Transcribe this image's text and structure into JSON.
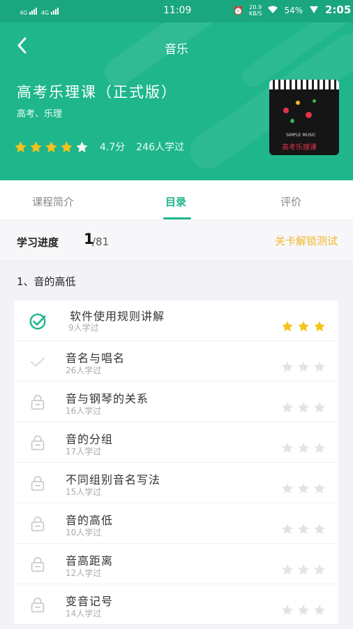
{
  "status_bar": {
    "network1": "4G",
    "network2": "4G",
    "time": "11:09",
    "speed": "20.9",
    "speed_unit": "KB/S",
    "battery": "54%",
    "clock": "2:05"
  },
  "nav": {
    "title": "音乐"
  },
  "course": {
    "title": "高考乐理课（正式版）",
    "tags": "高考、乐理",
    "rating_stars": 4.5,
    "score": "4.7分",
    "learners": "246人学过",
    "cover": {
      "caption": "SIMPLE MUSIC",
      "title": "高考乐理课"
    }
  },
  "tabs": [
    {
      "label": "课程简介",
      "active": false
    },
    {
      "label": "目录",
      "active": true
    },
    {
      "label": "评价",
      "active": false
    }
  ],
  "progress": {
    "label": "学习进度",
    "current": "1",
    "total": "/81",
    "unlock": "关卡解锁测试"
  },
  "section": {
    "title": "1、音的高低"
  },
  "lessons": [
    {
      "name": "软件使用规则讲解",
      "count": "9人学过",
      "state": "done",
      "stars": 3
    },
    {
      "name": "音名与唱名",
      "count": "26人学过",
      "state": "available",
      "stars": 0
    },
    {
      "name": "音与钢琴的关系",
      "count": "16人学过",
      "state": "locked",
      "stars": 0
    },
    {
      "name": "音的分组",
      "count": "17人学过",
      "state": "locked",
      "stars": 0
    },
    {
      "name": "不同组别音名写法",
      "count": "15人学过",
      "state": "locked",
      "stars": 0
    },
    {
      "name": "音的高低",
      "count": "10人学过",
      "state": "locked",
      "stars": 0
    },
    {
      "name": "音高距离",
      "count": "12人学过",
      "state": "locked",
      "stars": 0
    },
    {
      "name": "变音记号",
      "count": "14人学过",
      "state": "locked",
      "stars": 0
    }
  ],
  "colors": {
    "brand": "#1fb68b",
    "star_gold": "#f7c21b",
    "star_gray": "#e3e3e6",
    "unlock": "#f3b62c"
  },
  "icons": {
    "back": "chevron-left-icon",
    "done": "check-circle-icon",
    "available": "check-icon",
    "locked": "lock-icon",
    "star": "star-icon"
  }
}
